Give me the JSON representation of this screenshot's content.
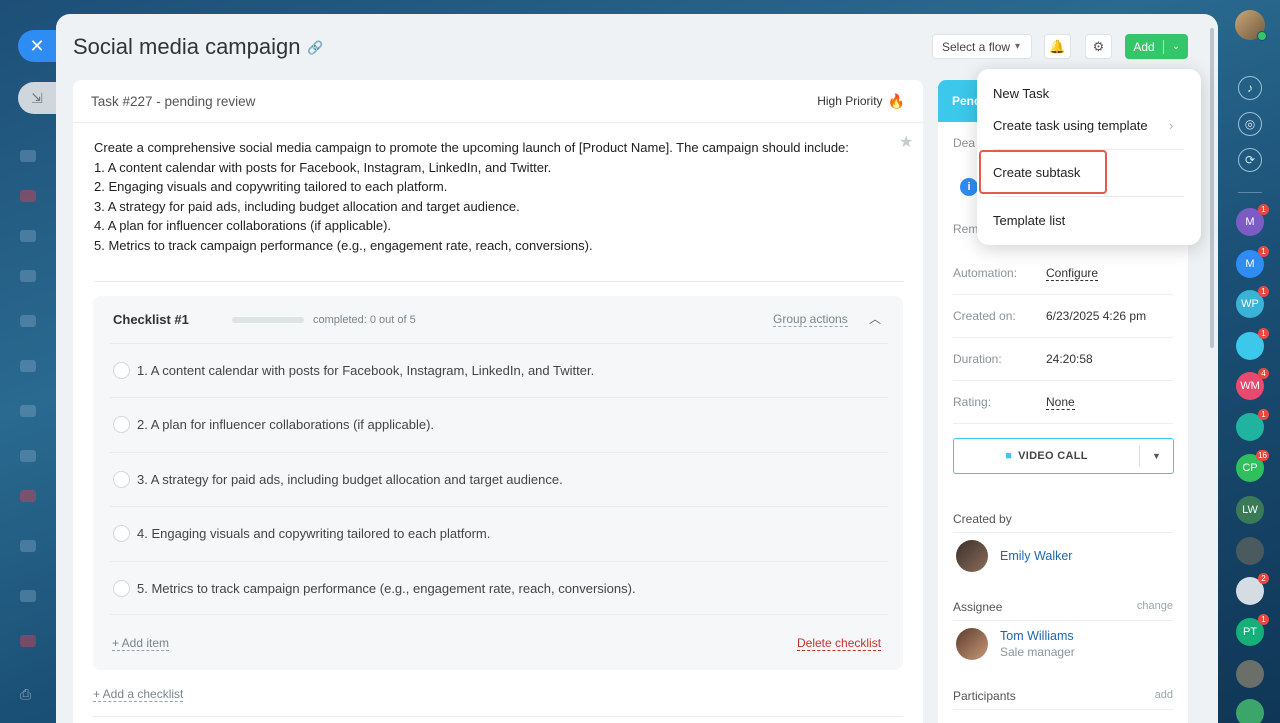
{
  "window": {
    "title": "Social media campaign",
    "flow_select": "Select a flow",
    "add_label": "Add"
  },
  "task": {
    "id_status": "Task #227 - pending review",
    "priority": "High Priority",
    "description": [
      "Create a comprehensive social media campaign to promote the upcoming launch of [Product Name]. The campaign should include:",
      "1. A content calendar with posts for Facebook, Instagram, LinkedIn, and Twitter.",
      "2. Engaging visuals and copywriting tailored to each platform.",
      "3. A strategy for paid ads, including budget allocation and target audience.",
      "4. A plan for influencer collaborations (if applicable).",
      "5. Metrics to track campaign performance (e.g., engagement rate, reach, conversions)."
    ]
  },
  "checklist": {
    "title": "Checklist #1",
    "progress_text": "completed: 0 out of 5",
    "progress": 0,
    "group_actions": "Group actions",
    "items": [
      "1. A content calendar with posts for Facebook, Instagram, LinkedIn, and Twitter.",
      "2. A plan for influencer collaborations (if applicable).",
      "3. A strategy for paid ads, including budget allocation and target audience.",
      "4. Engaging visuals and copywriting tailored to each platform.",
      "5. Metrics to track campaign performance (e.g., engagement rate, reach, conversions)."
    ],
    "add_item": "+ Add item",
    "delete": "Delete checklist",
    "add_checklist": "+ Add a checklist"
  },
  "info": {
    "status": "Pend",
    "deadline_label": "Dea",
    "reminder_label": "Rem",
    "automation_label": "Automation:",
    "automation_value": "Configure",
    "created_on_label": "Created on:",
    "created_on_value": "6/23/2025 4:26 pm",
    "duration_label": "Duration:",
    "duration_value": "24:20:58",
    "rating_label": "Rating:",
    "rating_value": "None",
    "video_call": "VIDEO CALL",
    "created_by_label": "Created by",
    "creator_name": "Emily Walker",
    "assignee_label": "Assignee",
    "assignee_change": "change",
    "assignee_name": "Tom Williams",
    "assignee_role": "Sale manager",
    "participants_label": "Participants",
    "participants_add": "add"
  },
  "dropdown": {
    "items": [
      "New Task",
      "Create task using template",
      "Create subtask",
      "Template list"
    ]
  },
  "rail": {
    "avatars": [
      {
        "initials": "M",
        "badge": "1",
        "color": "#7c5cc4"
      },
      {
        "initials": "M",
        "badge": "1",
        "color": "#2f8cf3"
      },
      {
        "initials": "WP",
        "badge": "1",
        "color": "#3bb3d6"
      },
      {
        "initials": "",
        "badge": "1",
        "color": "#3bc8eb"
      },
      {
        "initials": "WM",
        "badge": "4",
        "color": "#e8496f"
      },
      {
        "initials": "",
        "badge": "1",
        "color": "#20b3a0"
      },
      {
        "initials": "CP",
        "badge": "16",
        "color": "#2fbf5c"
      },
      {
        "initials": "LW",
        "badge": "",
        "color": "#3a7a56"
      },
      {
        "initials": "",
        "badge": "",
        "color": "#4a5a5f"
      },
      {
        "initials": "",
        "badge": "2",
        "color": "#d3dde3"
      },
      {
        "initials": "PT",
        "badge": "1",
        "color": "#15b07a"
      },
      {
        "initials": "",
        "badge": "",
        "color": "#6a6f6a"
      },
      {
        "initials": "",
        "badge": "",
        "color": "#3ca66a"
      }
    ]
  }
}
